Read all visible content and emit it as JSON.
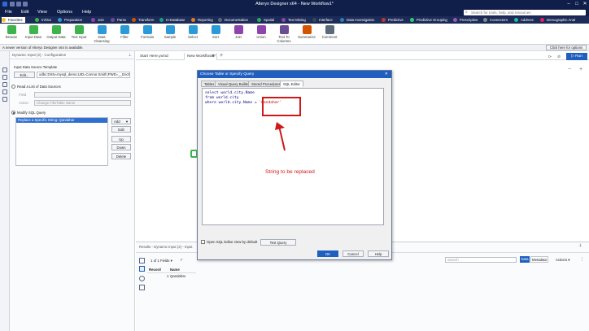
{
  "window": {
    "title": "Alteryx Designer x64 - New Workflow1*",
    "controls": [
      "–",
      "□",
      "✕"
    ]
  },
  "menu": {
    "items": [
      "File",
      "Edit",
      "View",
      "Options",
      "Help"
    ],
    "search_placeholder": "Search for tools, help, and resources"
  },
  "categories": [
    {
      "label": "Favorites",
      "color": "#f2c230",
      "selected": true
    },
    {
      "label": "In/Out",
      "color": "#3cb44b"
    },
    {
      "label": "Preparation",
      "color": "#2d9ad8"
    },
    {
      "label": "Join",
      "color": "#8e44ad"
    },
    {
      "label": "Parse",
      "color": "#6a4c93"
    },
    {
      "label": "Transform",
      "color": "#d35400"
    },
    {
      "label": "In-Database",
      "color": "#16a085"
    },
    {
      "label": "Reporting",
      "color": "#e67e22"
    },
    {
      "label": "Documentation",
      "color": "#5a6a7a"
    },
    {
      "label": "Spatial",
      "color": "#27ae60"
    },
    {
      "label": "Text Mining",
      "color": "#8e44ad"
    },
    {
      "label": "Interface",
      "color": "#34495e"
    },
    {
      "label": "Data Investigation",
      "color": "#2980b9"
    },
    {
      "label": "Predictive",
      "color": "#c0392b"
    },
    {
      "label": "Predictive Grouping",
      "color": "#2ecc71"
    },
    {
      "label": "Prescriptive",
      "color": "#9b59b6"
    },
    {
      "label": "Connectors",
      "color": "#7f8c8d"
    },
    {
      "label": "Address",
      "color": "#1abc9c"
    },
    {
      "label": "Demographic Anal",
      "color": "#e91e63"
    }
  ],
  "tools": [
    {
      "label": "Browse",
      "color": "#3cb44b"
    },
    {
      "label": "Input Data",
      "color": "#3cb44b"
    },
    {
      "label": "Output Data",
      "color": "#3cb44b"
    },
    {
      "label": "Text Input",
      "color": "#3cb44b"
    },
    {
      "label": "Data Cleansing",
      "color": "#2d9ad8"
    },
    {
      "label": "Filter",
      "color": "#2d9ad8"
    },
    {
      "label": "Formula",
      "color": "#2d9ad8"
    },
    {
      "label": "Sample",
      "color": "#2d9ad8"
    },
    {
      "label": "Select",
      "color": "#2d9ad8"
    },
    {
      "label": "Sort",
      "color": "#2d9ad8"
    },
    {
      "label": "Join",
      "color": "#8e44ad"
    },
    {
      "label": "Union",
      "color": "#8e44ad"
    },
    {
      "label": "Text To Columns",
      "color": "#6a4c93"
    },
    {
      "label": "Summarize",
      "color": "#d35400"
    },
    {
      "label": "Comment",
      "color": "#5a6a7a"
    }
  ],
  "infobar": {
    "message": "A newer version of Alteryx Designer x64 is available.",
    "link": "Click here for options"
  },
  "config": {
    "header": "Dynamic Input (2) - Configuration",
    "template_label": "Input Data Source Template",
    "edit_label": "Edit...",
    "template_value": "odbc:DSN=mysql_demo;UID=Connor.Smith;PWD=__EncPwd1",
    "read_list_label": "Read a List of Data Sources",
    "field_label": "Field",
    "action_label": "Action",
    "action_value": "Change File/Table Name",
    "modify_sql_label": "Modify SQL Query",
    "list_item": "Replace a Specific String: Qandahar",
    "add_label": "Add",
    "edit_btn": "Edit",
    "up_btn": "Up",
    "down_btn": "Down",
    "delete_btn": "Delete"
  },
  "canvas": {
    "tabs": [
      "Start Here.yxmd",
      "New Workflow1*"
    ],
    "run_label": "Run"
  },
  "dialog": {
    "title": "Choose Table or Specify Query",
    "tabs": [
      "Tables",
      "Visual Query Builder",
      "Stored Procedures",
      "SQL Editor"
    ],
    "sql_lines": [
      "select world.city.Name",
      "from world.city",
      "where world.city.Name = "
    ],
    "highlight": "'Qandahar'",
    "open_sql_label": "Open SQL Editor view by default",
    "test_query_label": "Test Query",
    "ok_label": "OK",
    "cancel_label": "Cancel",
    "help_label": "Help"
  },
  "annotation": {
    "text": "String to be replaced",
    "color": "#d01818"
  },
  "results": {
    "header": "Results - Dynamic Input (2) - Input",
    "fields_label": "1 of 1 Fields",
    "search_placeholder": "Search",
    "data_label": "Data",
    "metadata_label": "Metadata",
    "actions_label": "Actions",
    "columns": [
      "Record",
      "Name"
    ],
    "row": {
      "record": "1",
      "name": "Qandahar"
    }
  }
}
